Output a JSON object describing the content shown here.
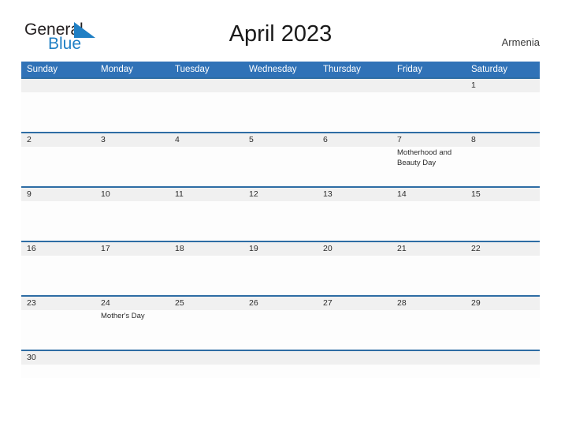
{
  "brand": {
    "name_top": "General",
    "name_bottom": "Blue",
    "flag_icon": "blue-triangle-flag-icon",
    "accent_color": "#1f7fc4"
  },
  "header": {
    "title": "April 2023",
    "country": "Armenia"
  },
  "colors": {
    "header_blue": "#3072b7",
    "row_divider_blue": "#2e6da4",
    "date_band_gray": "#f0f0f0",
    "text": "#2b2b2b"
  },
  "calendar": {
    "weekdays": [
      "Sunday",
      "Monday",
      "Tuesday",
      "Wednesday",
      "Thursday",
      "Friday",
      "Saturday"
    ],
    "weeks": [
      {
        "dates": [
          "",
          "",
          "",
          "",
          "",
          "",
          "1"
        ],
        "events": [
          "",
          "",
          "",
          "",
          "",
          "",
          ""
        ]
      },
      {
        "dates": [
          "2",
          "3",
          "4",
          "5",
          "6",
          "7",
          "8"
        ],
        "events": [
          "",
          "",
          "",
          "",
          "",
          "Motherhood and Beauty Day",
          ""
        ]
      },
      {
        "dates": [
          "9",
          "10",
          "11",
          "12",
          "13",
          "14",
          "15"
        ],
        "events": [
          "",
          "",
          "",
          "",
          "",
          "",
          ""
        ]
      },
      {
        "dates": [
          "16",
          "17",
          "18",
          "19",
          "20",
          "21",
          "22"
        ],
        "events": [
          "",
          "",
          "",
          "",
          "",
          "",
          ""
        ]
      },
      {
        "dates": [
          "23",
          "24",
          "25",
          "26",
          "27",
          "28",
          "29"
        ],
        "events": [
          "",
          "Mother's Day",
          "",
          "",
          "",
          "",
          ""
        ]
      },
      {
        "dates": [
          "30",
          "",
          "",
          "",
          "",
          "",
          ""
        ],
        "events": [
          "",
          "",
          "",
          "",
          "",
          "",
          ""
        ]
      }
    ]
  }
}
